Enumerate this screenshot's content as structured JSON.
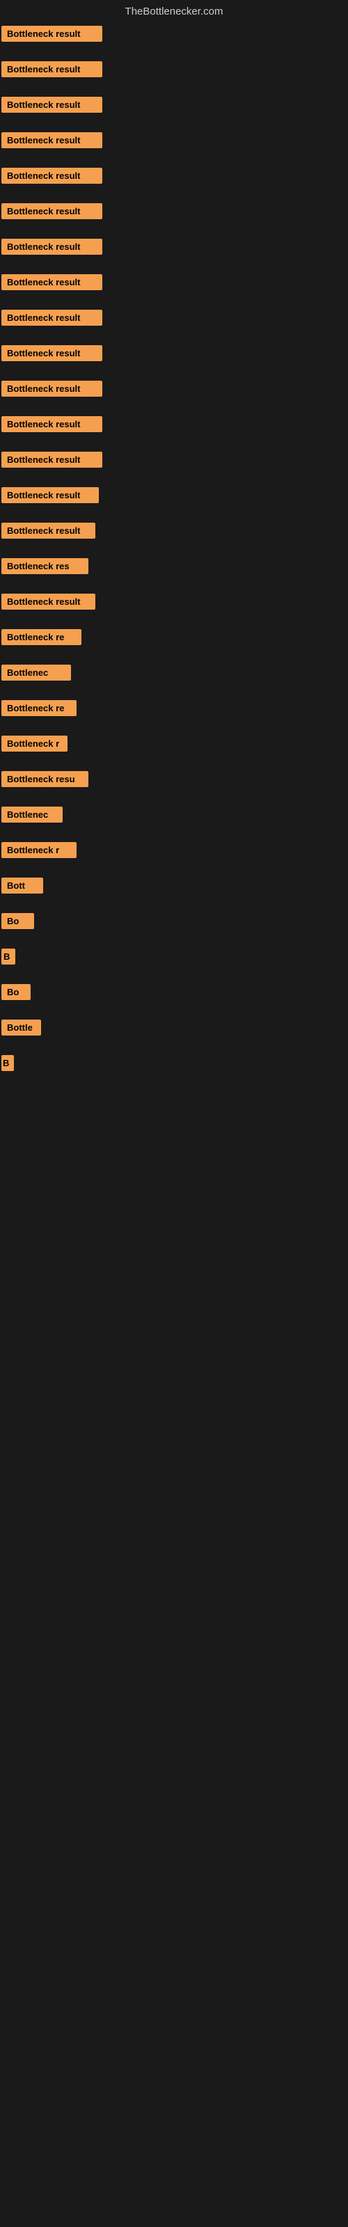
{
  "header": {
    "title": "TheBottlenecker.com"
  },
  "rows": [
    {
      "id": 1,
      "label": "Bottleneck result"
    },
    {
      "id": 2,
      "label": "Bottleneck result"
    },
    {
      "id": 3,
      "label": "Bottleneck result"
    },
    {
      "id": 4,
      "label": "Bottleneck result"
    },
    {
      "id": 5,
      "label": "Bottleneck result"
    },
    {
      "id": 6,
      "label": "Bottleneck result"
    },
    {
      "id": 7,
      "label": "Bottleneck result"
    },
    {
      "id": 8,
      "label": "Bottleneck result"
    },
    {
      "id": 9,
      "label": "Bottleneck result"
    },
    {
      "id": 10,
      "label": "Bottleneck result"
    },
    {
      "id": 11,
      "label": "Bottleneck result"
    },
    {
      "id": 12,
      "label": "Bottleneck result"
    },
    {
      "id": 13,
      "label": "Bottleneck result"
    },
    {
      "id": 14,
      "label": "Bottleneck result"
    },
    {
      "id": 15,
      "label": "Bottleneck result"
    },
    {
      "id": 16,
      "label": "Bottleneck res"
    },
    {
      "id": 17,
      "label": "Bottleneck result"
    },
    {
      "id": 18,
      "label": "Bottleneck re"
    },
    {
      "id": 19,
      "label": "Bottlenec"
    },
    {
      "id": 20,
      "label": "Bottleneck re"
    },
    {
      "id": 21,
      "label": "Bottleneck r"
    },
    {
      "id": 22,
      "label": "Bottleneck resu"
    },
    {
      "id": 23,
      "label": "Bottlenec"
    },
    {
      "id": 24,
      "label": "Bottleneck r"
    },
    {
      "id": 25,
      "label": "Bott"
    },
    {
      "id": 26,
      "label": "Bo"
    },
    {
      "id": 27,
      "label": "B"
    },
    {
      "id": 28,
      "label": "Bo"
    },
    {
      "id": 29,
      "label": "Bottle"
    },
    {
      "id": 30,
      "label": "B"
    }
  ],
  "colors": {
    "background": "#1a1a1a",
    "bar": "#f5a050",
    "header_text": "#cccccc",
    "bar_text": "#000000"
  }
}
